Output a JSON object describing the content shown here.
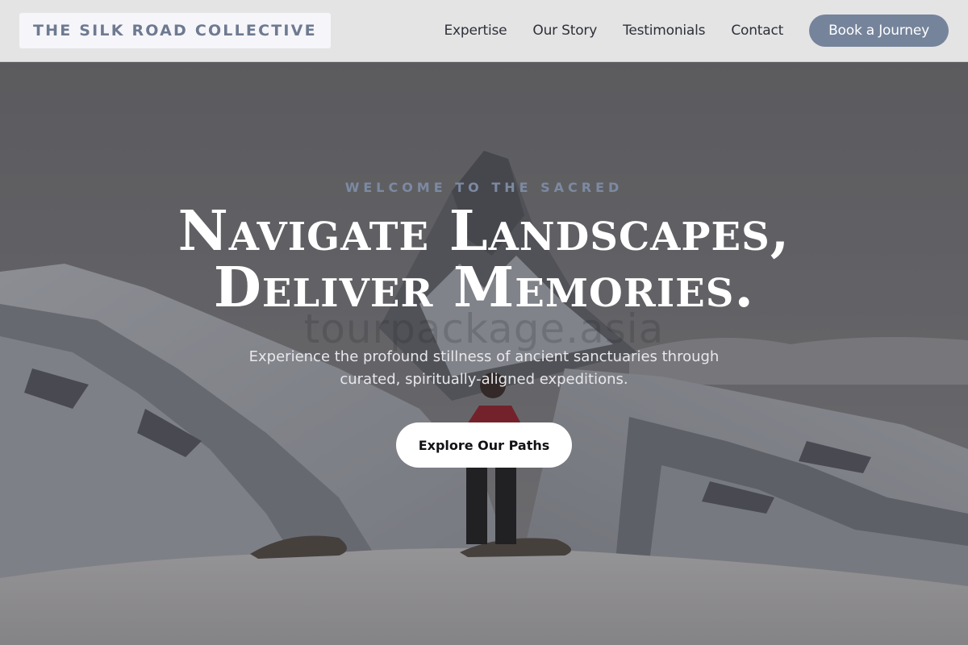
{
  "brand": {
    "name": "THE SILK ROAD COLLECTIVE"
  },
  "nav": {
    "items": [
      "Expertise",
      "Our Story",
      "Testimonials",
      "Contact"
    ],
    "cta_label": "Book a Journey"
  },
  "hero": {
    "eyebrow": "WELCOME TO THE SACRED",
    "headline_line1": "Navigate Landscapes,",
    "headline_line2": "Deliver Memories.",
    "watermark": "tourpackage.asia",
    "subtext_line1": "Experience the profound stillness of ancient sanctuaries through",
    "subtext_line2": "curated, spiritually-aligned expeditions.",
    "cta_label": "Explore Our Paths"
  },
  "colors": {
    "header_bg": "#e4e4e5",
    "brand_text": "#6e7a90",
    "book_button_bg": "#75849b",
    "eyebrow_text": "#7c8aa2",
    "hero_cta_bg": "#ffffff"
  }
}
